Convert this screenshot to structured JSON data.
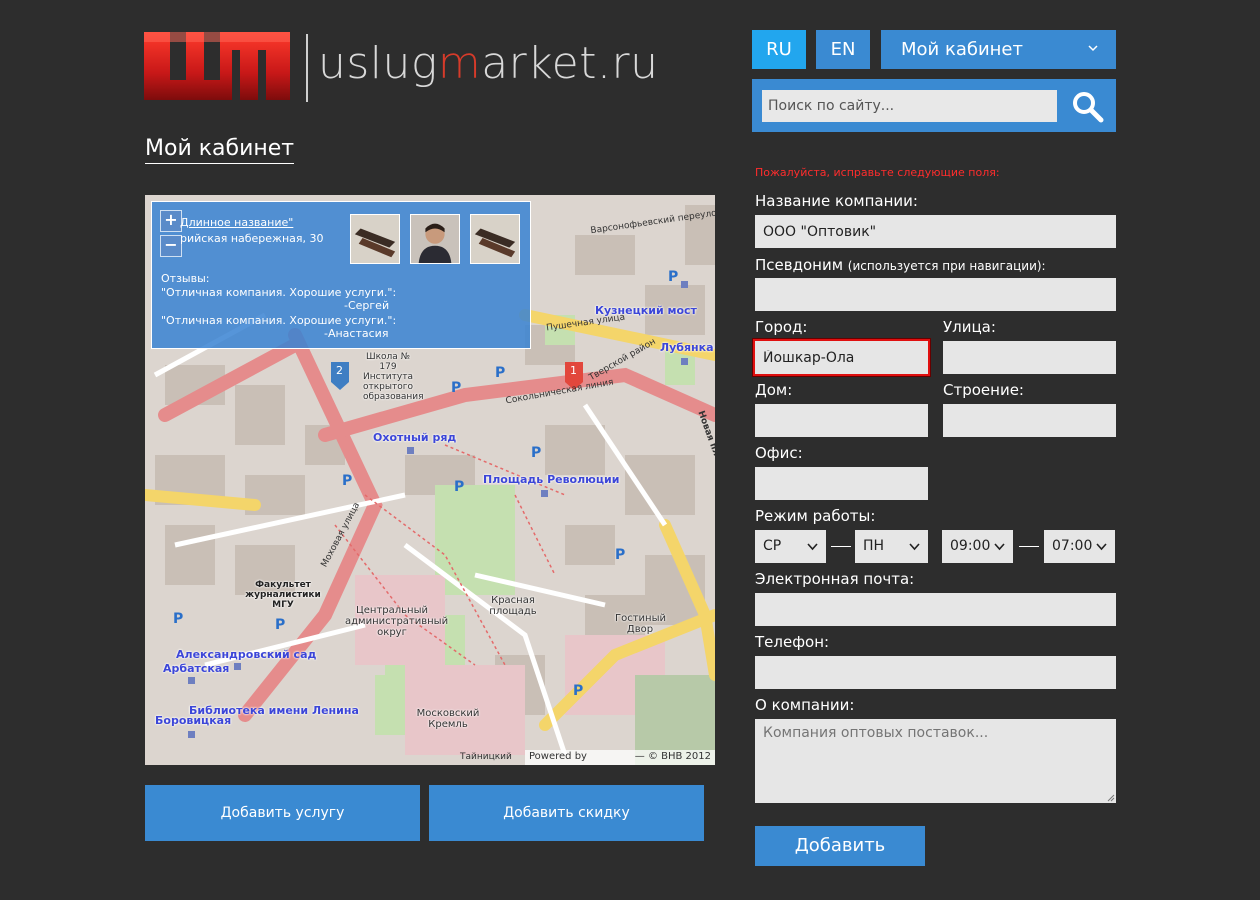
{
  "logo": {
    "part1": "uslug",
    "part2": "m",
    "part3": "arket.ru"
  },
  "page_title": "Мой кабинет",
  "header": {
    "lang_ru": "RU",
    "lang_en": "EN",
    "cabinet_label": "Мой кабинет",
    "search_placeholder": "Поиск по сайту..."
  },
  "map": {
    "popup": {
      "name": "Длинное название\"",
      "address": "рийская набережная, 30",
      "reviews_title": "Отзывы:",
      "review1": "\"Отличная компания. Хорошие услуги.\":",
      "author1": "-Сергей",
      "review2": "\"Отличная компания. Хорошие услуги.\":",
      "author2": "-Анастасия"
    },
    "markers": [
      "1",
      "2"
    ],
    "labels": {
      "kuznetsky": "Кузнецкий мост",
      "lubyanka": "Лубянка",
      "okhotny": "Охотный ряд",
      "revolution": "Площадь Революции",
      "alexandrovsky": "Александровский сад",
      "arbatskaya": "Арбатская",
      "lenin_lib": "Библиотека имени Ленина",
      "borovitskaya": "Боровицкая",
      "red_square": "Красная площадь",
      "kremlin": "Московский Кремль",
      "gostiny": "Гостиный Двор",
      "faculty": "Факультет журналистики МГУ",
      "central": "Центральный административный округ",
      "school": "Школа № 179 Института открытого образования",
      "pushechnaya": "Пушечная улица",
      "mokhovaya": "Моховая улица",
      "sokolnicheskaya": "Сокольническая линия",
      "tverskoy": "Тверской район",
      "varsonofevsky": "Варсонофьевский переулок",
      "novaya": "Новая площадь",
      "tainitskiy": "Тайницкий"
    },
    "attribution_powered": "Powered by",
    "attribution_copy": "— © BHB 2012"
  },
  "actions": {
    "add_service": "Добавить услугу",
    "add_discount": "Добавить скидку"
  },
  "form": {
    "error_message": "Пожалуйста, исправьте следующие поля:",
    "company_name_label": "Название компании:",
    "company_name_value": "ООО \"Оптовик\"",
    "alias_label": "Псевдоним",
    "alias_hint": "(используется при навигации):",
    "alias_value": "",
    "city_label": "Город:",
    "city_value": "Йошкар-Ола",
    "street_label": "Улица:",
    "street_value": "",
    "house_label": "Дом:",
    "house_value": "",
    "building_label": "Строение:",
    "building_value": "",
    "office_label": "Офис:",
    "office_value": "",
    "hours_label": "Режим работы:",
    "day_from": "СР",
    "day_to": "ПН",
    "time_from": "09:00",
    "time_to": "07:00",
    "email_label": "Электронная почта:",
    "email_value": "",
    "phone_label": "Телефон:",
    "phone_value": "",
    "about_label": "О компании:",
    "about_placeholder": "Компания оптовых поставок...",
    "submit_label": "Добавить"
  },
  "colors": {
    "background": "#2d2d2d",
    "accent": "#3a8ad2",
    "accent_active": "#22a6ee",
    "logo_red": "#d63b2a",
    "error": "#ff2d2d"
  }
}
